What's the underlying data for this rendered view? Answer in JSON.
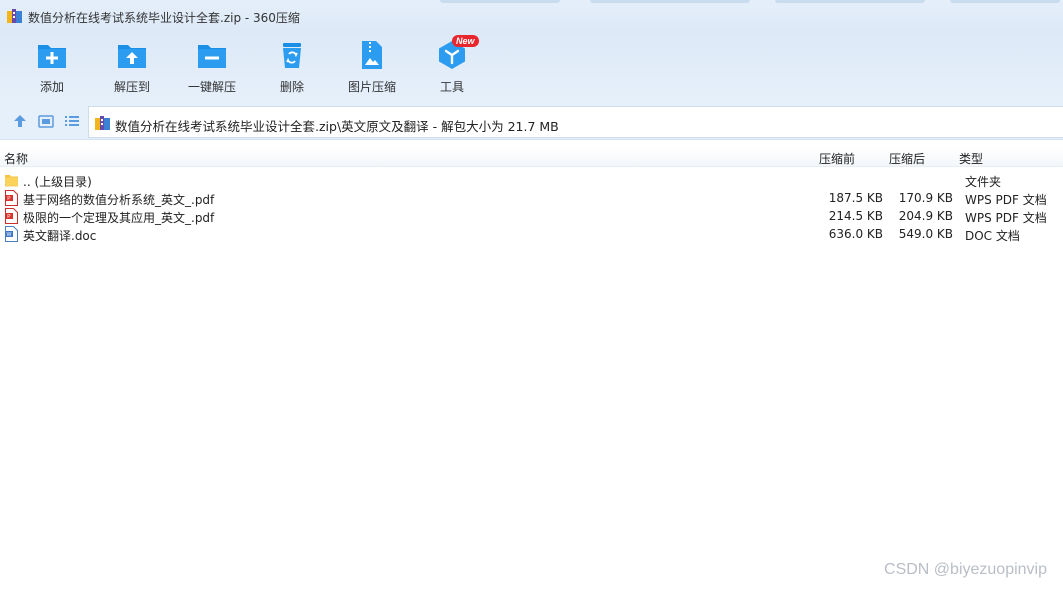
{
  "window": {
    "title": "数值分析在线考试系统毕业设计全套.zip - 360压缩"
  },
  "toolbar": {
    "items": [
      {
        "label": "添加",
        "icon": "add-folder-icon"
      },
      {
        "label": "解压到",
        "icon": "extract-to-icon"
      },
      {
        "label": "一键解压",
        "icon": "one-click-extract-icon"
      },
      {
        "label": "删除",
        "icon": "recycle-bin-icon"
      },
      {
        "label": "图片压缩",
        "icon": "image-compress-icon"
      },
      {
        "label": "工具",
        "icon": "tools-icon",
        "badge": "New"
      }
    ],
    "accent_color": "#1a8fe8"
  },
  "navbar": {
    "path": "数值分析在线考试系统毕业设计全套.zip\\英文原文及翻译 - 解包大小为 21.7 MB"
  },
  "columns": {
    "name": "名称",
    "before": "压缩前",
    "after": "压缩后",
    "type": "类型"
  },
  "files": [
    {
      "name": ".. (上级目录)",
      "before": "",
      "after": "",
      "type": "文件夹",
      "icon": "folder-icon"
    },
    {
      "name": "基于网络的数值分析系统_英文_.pdf",
      "before": "187.5 KB",
      "after": "170.9 KB",
      "type": "WPS PDF 文档",
      "icon": "pdf-file-icon"
    },
    {
      "name": "极限的一个定理及其应用_英文_.pdf",
      "before": "214.5 KB",
      "after": "204.9 KB",
      "type": "WPS PDF 文档",
      "icon": "pdf-file-icon"
    },
    {
      "name": "英文翻译.doc",
      "before": "636.0 KB",
      "after": "549.0 KB",
      "type": "DOC 文档",
      "icon": "doc-file-icon"
    }
  ],
  "watermark": "CSDN @biyezuopinvip"
}
